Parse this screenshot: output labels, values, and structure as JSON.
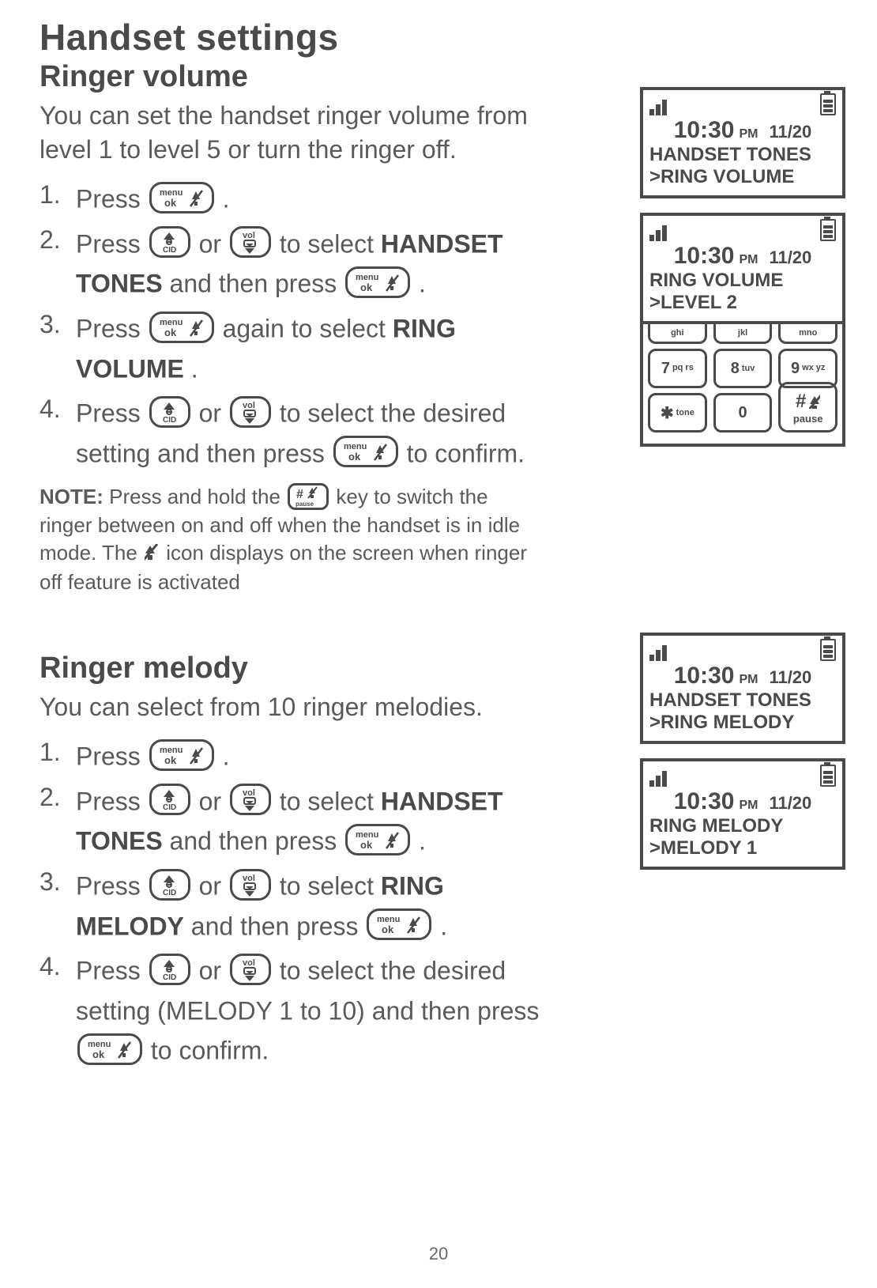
{
  "page_number": "20",
  "title": "Handset settings",
  "section1": {
    "heading": "Ringer volume",
    "intro": "You can set the handset ringer volume from level 1 to level 5 or turn the ringer off.",
    "steps": {
      "n1": "1.",
      "s1a": "Press ",
      "s1b": ".",
      "n2": "2.",
      "s2a": "Press ",
      "s2b": " or ",
      "s2c": " to select ",
      "s2bold": "HANDSET TONES",
      "s2d": " and then press ",
      "s2e": ".",
      "n3": "3.",
      "s3a": "Press ",
      "s3b": " again to select ",
      "s3bold": "RING VOLUME",
      "s3c": ".",
      "n4": "4.",
      "s4a": "Press ",
      "s4b": " or ",
      "s4c": " to select the desired setting and then press ",
      "s4d": " to confirm."
    },
    "note": {
      "label": "NOTE:",
      "a": " Press and hold the ",
      "b": " key to switch the ringer between on and off when the handset is in idle mode. The ",
      "c": " icon displays on the screen when ringer off feature is activated"
    }
  },
  "section2": {
    "heading": "Ringer melody",
    "intro": "You can select from 10 ringer melodies.",
    "steps": {
      "n1": "1.",
      "s1a": "Press ",
      "s1b": ".",
      "n2": "2.",
      "s2a": "Press ",
      "s2b": " or ",
      "s2c": " to select ",
      "s2bold": "HANDSET TONES",
      "s2d": " and then press ",
      "s2e": ".",
      "n3": "3.",
      "s3a": "Press ",
      "s3b": " or ",
      "s3c": " to select ",
      "s3bold": "RING MELODY",
      "s3d": " and then press ",
      "s3e": ".",
      "n4": "4.",
      "s4a": "Press ",
      "s4b": " or ",
      "s4c": " to select the desired setting (MELODY 1 to 10) and then press ",
      "s4d": " to confirm."
    }
  },
  "screens": {
    "time": "10:30",
    "ampm": "PM",
    "date": "11/20",
    "s1l1": "HANDSET TONES",
    "s1l2": ">RING VOLUME",
    "s2l1": "RING VOLUME",
    "s2l2": ">LEVEL 2",
    "s3l1": "HANDSET TONES",
    "s3l2": ">RING MELODY",
    "s4l1": "RING MELODY",
    "s4l2": ">MELODY 1"
  },
  "keypad": {
    "k4s": "ghi",
    "k5s": "jkl",
    "k6s": "mno",
    "k7": "7",
    "k7s": "pq rs",
    "k8": "8",
    "k8s": "tuv",
    "k9": "9",
    "k9s": "wx yz",
    "star": "✱",
    "stars": "tone",
    "k0": "0",
    "hash": "#",
    "pause": "pause"
  }
}
